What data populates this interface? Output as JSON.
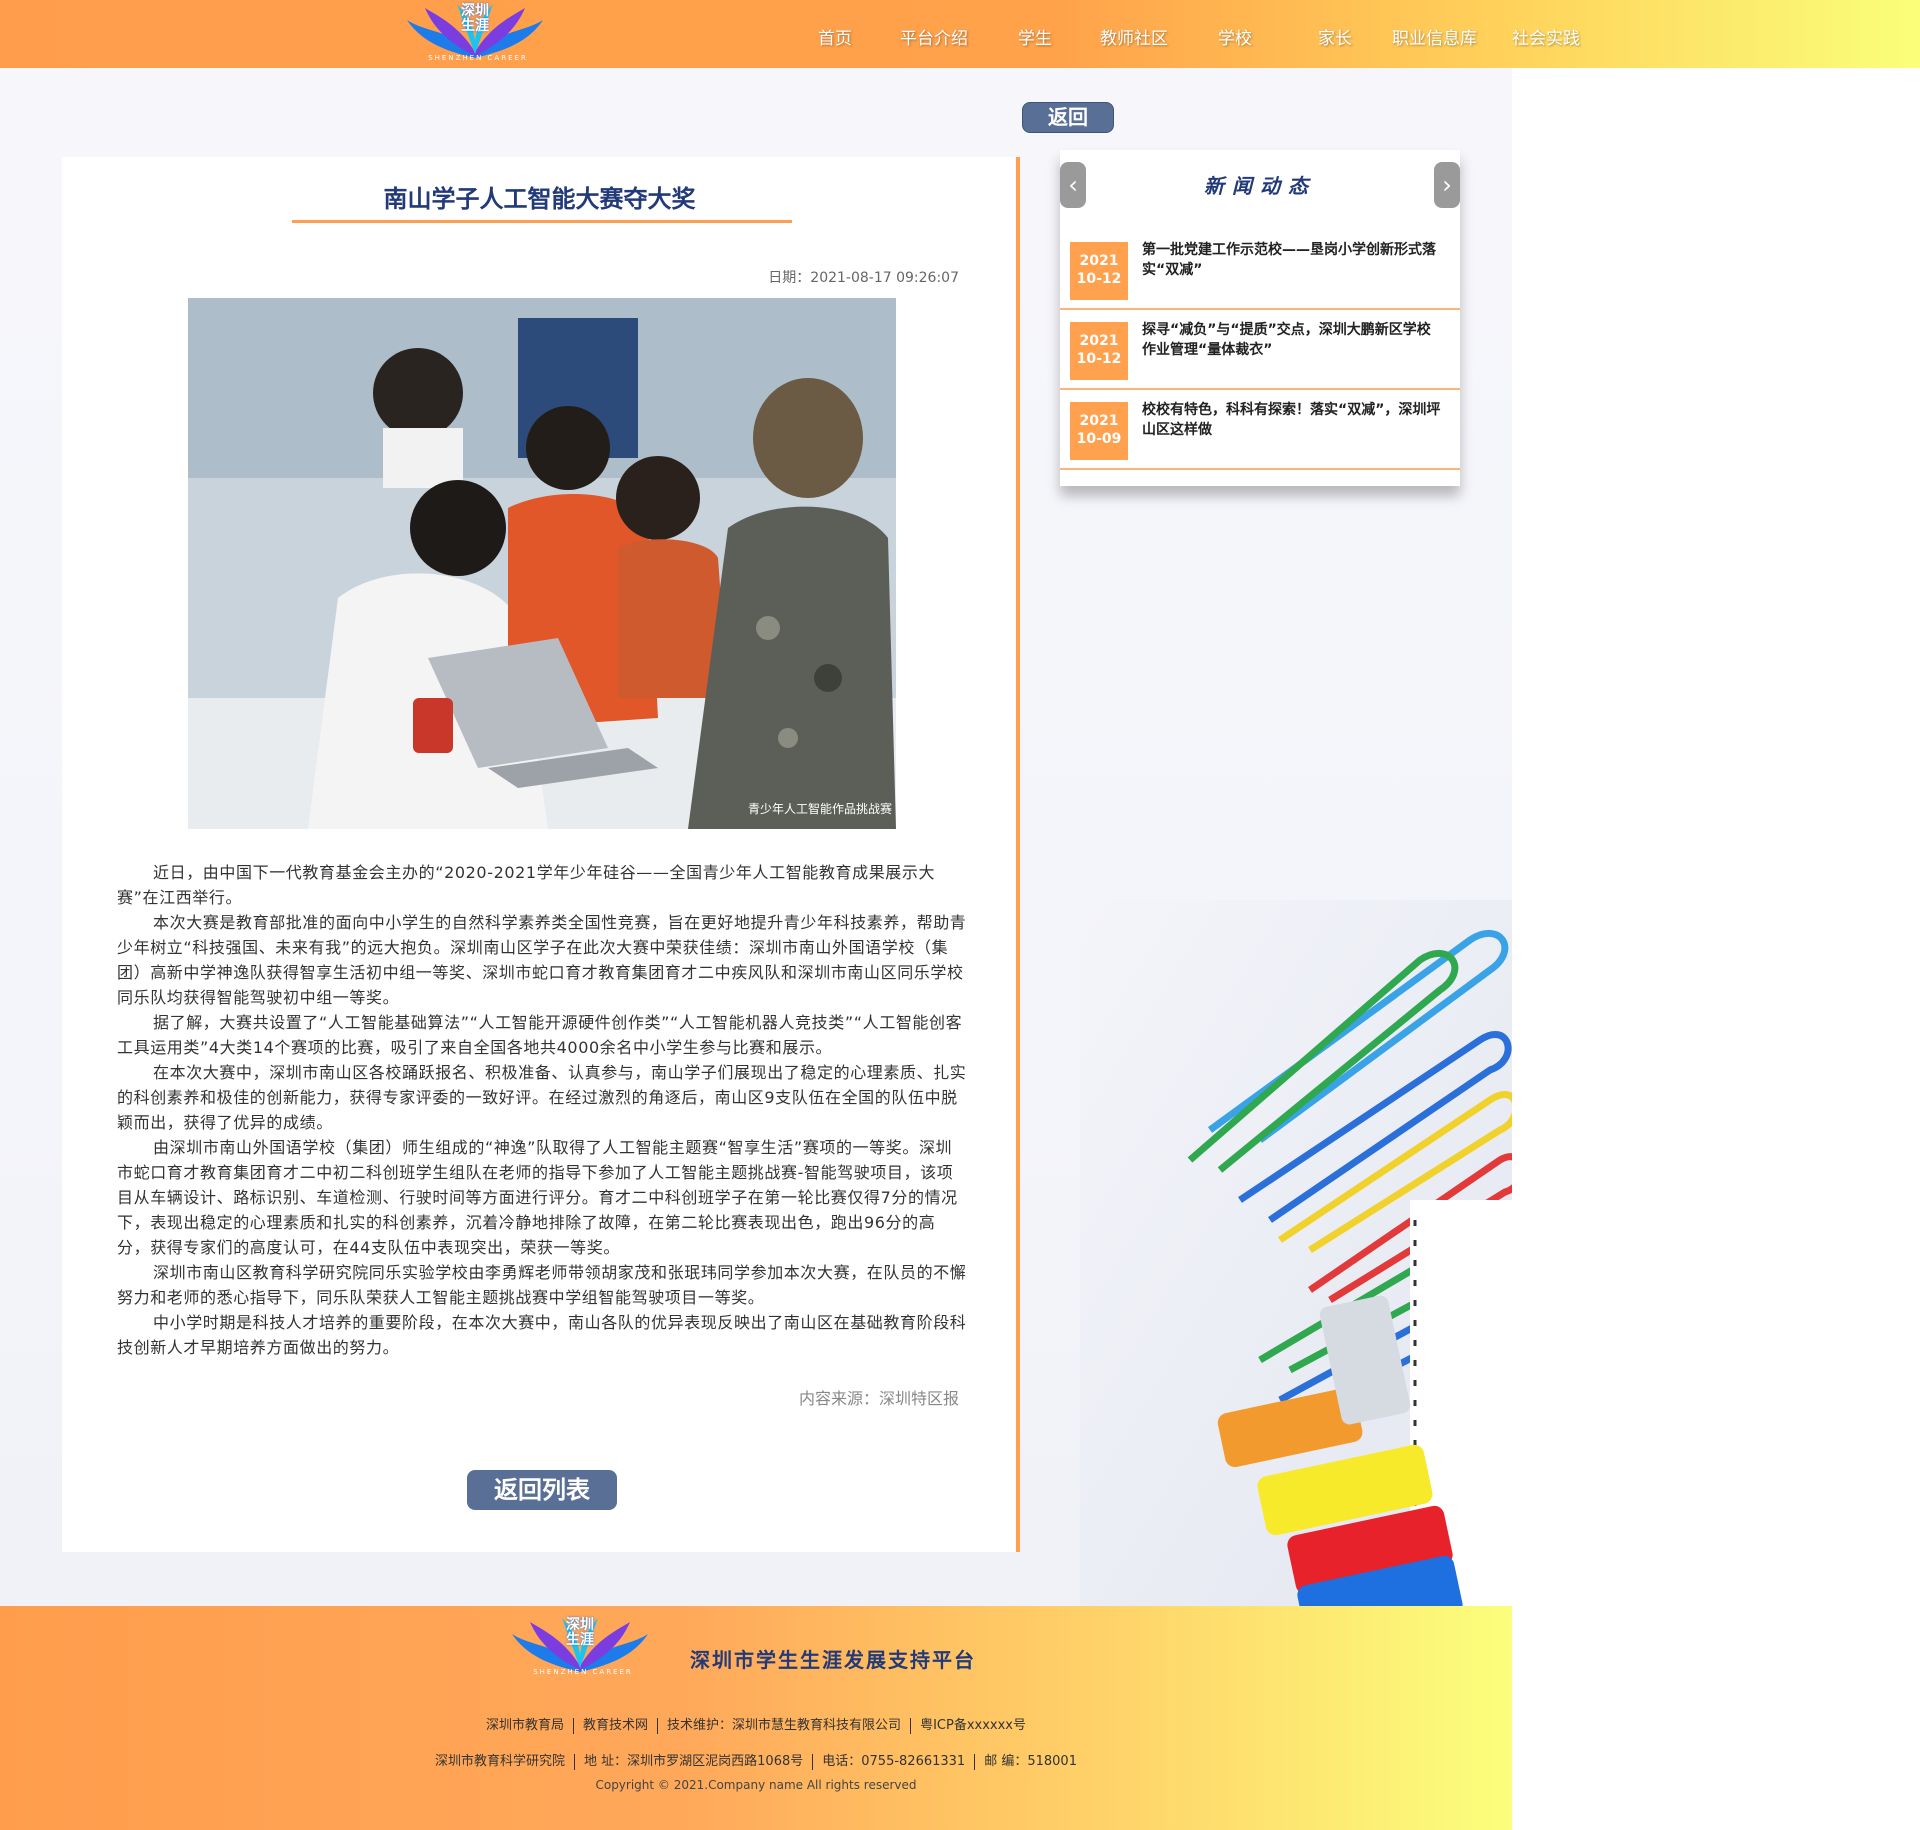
{
  "header": {
    "logo_text": "深圳\n生涯",
    "logo_sub": "SHENZHEN CAREER",
    "nav": [
      {
        "label": "首页"
      },
      {
        "label": "平台介绍"
      },
      {
        "label": "学生"
      },
      {
        "label": "教师社区"
      },
      {
        "label": "学校"
      },
      {
        "label": "家长"
      },
      {
        "label": "职业信息库"
      },
      {
        "label": "社会实践"
      }
    ]
  },
  "back_button": "返回",
  "article": {
    "title": "南山学子人工智能大赛夺大奖",
    "date": "日期：2021-08-17 09:26:07",
    "photo_caption": "青少年人工智能作品挑战赛",
    "paragraphs": [
      "近日，由中国下一代教育基金会主办的“2020-2021学年少年硅谷——全国青少年人工智能教育成果展示大赛”在江西举行。",
      "本次大赛是教育部批准的面向中小学生的自然科学素养类全国性竞赛，旨在更好地提升青少年科技素养，帮助青少年树立“科技强国、未来有我”的远大抱负。深圳南山区学子在此次大赛中荣获佳绩：深圳市南山外国语学校（集团）高新中学神逸队获得智享生活初中组一等奖、深圳市蛇口育才教育集团育才二中疾风队和深圳市南山区同乐学校同乐队均获得智能驾驶初中组一等奖。",
      "据了解，大赛共设置了“人工智能基础算法”“人工智能开源硬件创作类”“人工智能机器人竞技类”“人工智能创客工具运用类”4大类14个赛项的比赛，吸引了来自全国各地共4000余名中小学生参与比赛和展示。",
      "在本次大赛中，深圳市南山区各校踊跃报名、积极准备、认真参与，南山学子们展现出了稳定的心理素质、扎实的科创素养和极佳的创新能力，获得专家评委的一致好评。在经过激烈的角逐后，南山区9支队伍在全国的队伍中脱颖而出，获得了优异的成绩。",
      "由深圳市南山外国语学校（集团）师生组成的“神逸”队取得了人工智能主题赛“智享生活”赛项的一等奖。深圳市蛇口育才教育集团育才二中初二科创班学生组队在老师的指导下参加了人工智能主题挑战赛-智能驾驶项目，该项目从车辆设计、路标识别、车道检测、行驶时间等方面进行评分。育才二中科创班学子在第一轮比赛仅得7分的情况下，表现出稳定的心理素质和扎实的科创素养，沉着冷静地排除了故障，在第二轮比赛表现出色，跑出96分的高分，获得专家们的高度认可，在44支队伍中表现突出，荣获一等奖。",
      "深圳市南山区教育科学研究院同乐实验学校由李勇辉老师带领胡家茂和张珉玮同学参加本次大赛，在队员的不懈努力和老师的悉心指导下，同乐队荣获人工智能主题挑战赛中学组智能驾驶项目一等奖。",
      "中小学时期是科技人才培养的重要阶段，在本次大赛中，南山各队的优异表现反映出了南山区在基础教育阶段科技创新人才早期培养方面做出的努力。"
    ],
    "source": "内容来源：深圳特区报",
    "list_button": "返回列表"
  },
  "news": {
    "heading": "新闻动态",
    "prev_icon": "chevron-left-icon",
    "next_icon": "chevron-right-icon",
    "items": [
      {
        "year": "2021",
        "md": "10-12",
        "title": "第一批党建工作示范校——垦岗小学创新形式落实“双减”"
      },
      {
        "year": "2021",
        "md": "10-12",
        "title": "探寻“减负”与“提质”交点，深圳大鹏新区学校作业管理“量体裁衣”"
      },
      {
        "year": "2021",
        "md": "10-09",
        "title": "校校有特色，科科有探索！落实“双减”，深圳坪山区这样做"
      }
    ]
  },
  "footer": {
    "logo_text": "深圳\n生涯",
    "logo_sub": "SHENZHEN CAREER",
    "title": "深圳市学生生涯发展支持平台",
    "row1": [
      "深圳市教育局",
      "教育技术网",
      "技术维护：深圳市慧生教育科技有限公司",
      "粤ICP备xxxxxx号"
    ],
    "row2": [
      "深圳市教育科学研究院",
      "地  址：深圳市罗湖区泥岗西路1068号",
      "电话：0755-82661331",
      "邮  编：518001"
    ],
    "copyright": "Copyright © 2021.Company name All rights reserved"
  },
  "colors": {
    "accent": "#ff9f4f",
    "navy": "#233a78",
    "button": "#5a6f96"
  }
}
